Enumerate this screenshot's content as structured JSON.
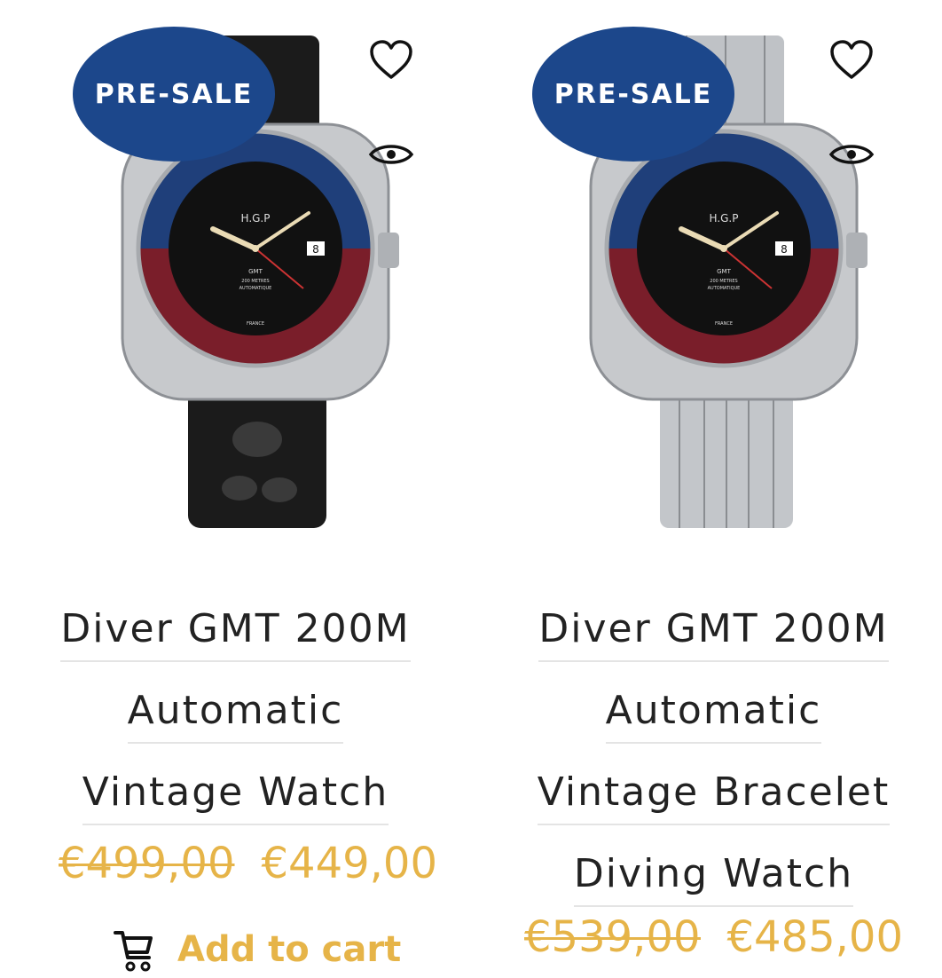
{
  "products": [
    {
      "badge": "PRE-SALE",
      "title_lines": [
        "Diver GMT 200M",
        "Automatic",
        "Vintage Watch"
      ],
      "old_price": "€499,00",
      "price": "€449,00",
      "cart_label": "Add to cart",
      "dial_brand": "H.G.P",
      "dial_text": [
        "GMT",
        "200 METRES",
        "AUTOMATIQUE",
        "FRANCE"
      ],
      "date_window": "8",
      "strap": "rubber"
    },
    {
      "badge": "PRE-SALE",
      "title_lines": [
        "Diver GMT 200M",
        "Automatic",
        "Vintage Bracelet",
        "Diving Watch"
      ],
      "old_price": "€539,00",
      "price": "€485,00",
      "dial_brand": "H.G.P",
      "dial_text": [
        "GMT",
        "200 METRES",
        "AUTOMATIQUE",
        "FRANCE"
      ],
      "date_window": "8",
      "strap": "steel bracelet"
    }
  ],
  "colors": {
    "badge": "#1c478b",
    "price": "#e6b448",
    "bezel_blue": "#1f3f7a",
    "bezel_red": "#7a1e2a"
  },
  "icons": [
    "heart-icon",
    "eye-icon",
    "cart-icon"
  ]
}
